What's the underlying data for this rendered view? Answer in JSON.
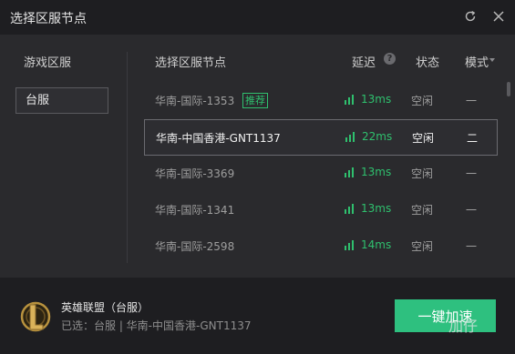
{
  "window": {
    "title": "选择区服节点",
    "refresh_icon": "refresh-icon",
    "close_icon": "close-icon"
  },
  "left_panel": {
    "header": "游戏区服",
    "regions": [
      {
        "label": "台服",
        "selected": true
      }
    ]
  },
  "table": {
    "headers": {
      "node": "选择区服节点",
      "delay": "延迟",
      "delay_help": "?",
      "status": "状态",
      "mode": "模式"
    },
    "rows": [
      {
        "name": "华南-国际-1353",
        "badge": "推荐",
        "latency": "13ms",
        "status": "空闲",
        "mode": "一",
        "selected": false
      },
      {
        "name": "华南-中国香港-GNT1137",
        "badge": "",
        "latency": "22ms",
        "status": "空闲",
        "mode": "二",
        "selected": true
      },
      {
        "name": "华南-国际-3369",
        "badge": "",
        "latency": "13ms",
        "status": "空闲",
        "mode": "一",
        "selected": false
      },
      {
        "name": "华南-国际-1341",
        "badge": "",
        "latency": "13ms",
        "status": "空闲",
        "mode": "一",
        "selected": false
      },
      {
        "name": "华南-国际-2598",
        "badge": "",
        "latency": "14ms",
        "status": "空闲",
        "mode": "一",
        "selected": false
      }
    ]
  },
  "footer": {
    "game_name": "英雄联盟（台服）",
    "selected_line": "已选：台服 | 华南-中国香港-GNT1137",
    "accelerate_label": "一键加速",
    "watermark": "加仔"
  },
  "colors": {
    "accent_green": "#2ec07f",
    "latency_green": "#2fc06e",
    "background": "#2a2a2d",
    "bar_background": "#1e1e21"
  }
}
